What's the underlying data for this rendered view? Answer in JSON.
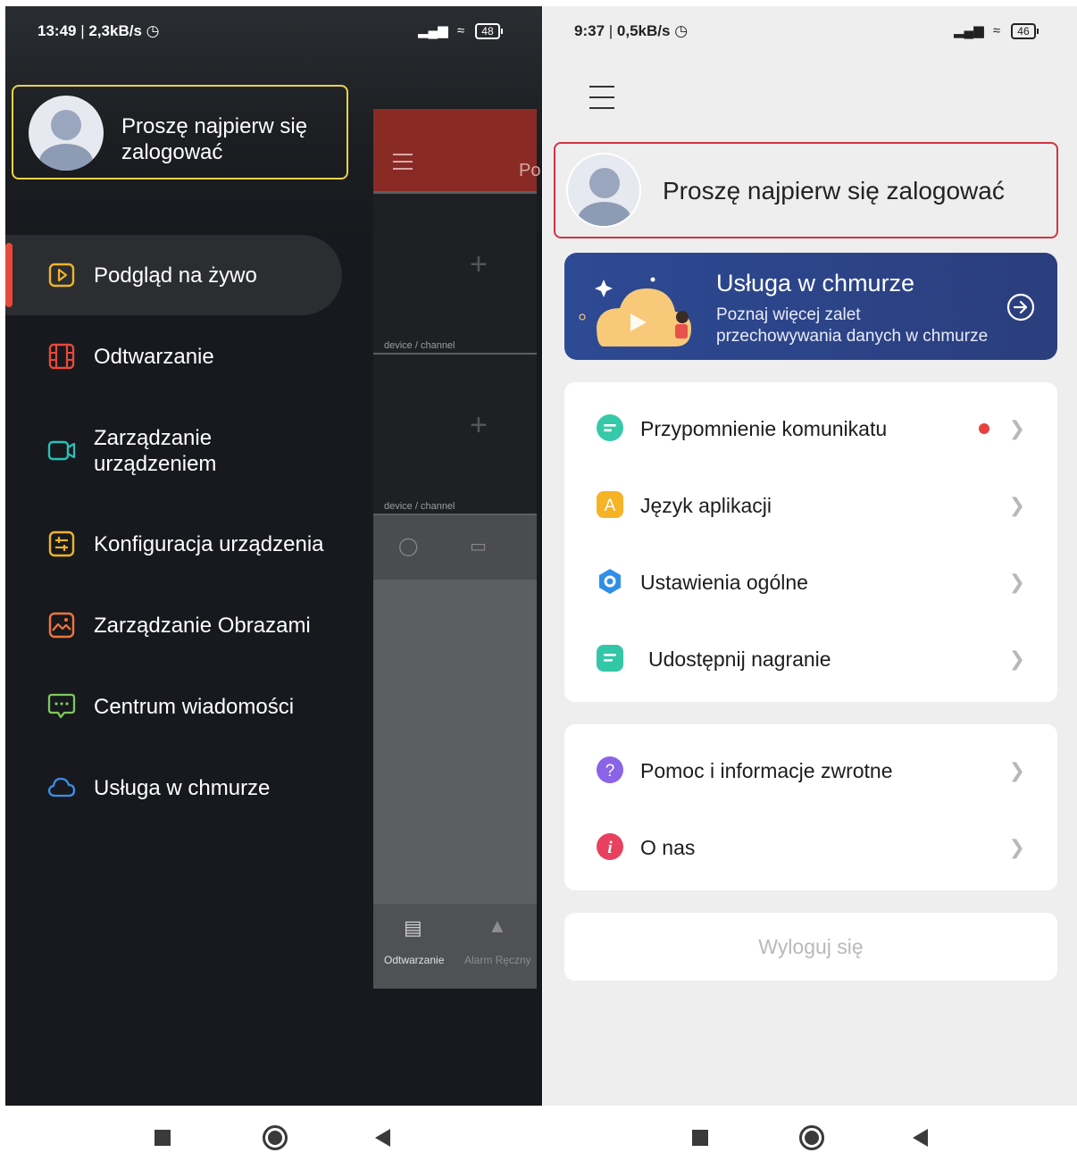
{
  "left_screen": {
    "status_bar": {
      "time": "13:49",
      "speed": "2,3kB/s",
      "battery": "48"
    },
    "login_prompt": "Proszę najpierw się zalogować",
    "menu_items": [
      {
        "label": "Podgląd na żywo",
        "icon": "play-square-icon",
        "color": "#f0b428",
        "active": true
      },
      {
        "label": "Odtwarzanie",
        "icon": "film-icon",
        "color": "#e8493b"
      },
      {
        "label": "Zarządzanie urządzeniem",
        "icon": "camera-icon",
        "color": "#26c2b8"
      },
      {
        "label": "Konfiguracja urządzenia",
        "icon": "sliders-icon",
        "color": "#f0b428"
      },
      {
        "label": "Zarządzanie Obrazami",
        "icon": "image-icon",
        "color": "#f0753a"
      },
      {
        "label": "Centrum wiadomości",
        "icon": "chat-icon",
        "color": "#7ec85a"
      },
      {
        "label": "Usługa w chmurze",
        "icon": "cloud-icon",
        "color": "#3d8ee8"
      }
    ],
    "background_app": {
      "header_text": "Po",
      "channel_labels": [
        "device / channel",
        "device / channel"
      ],
      "bottom_tabs": [
        "Odtwarzanie",
        "Alarm Ręczny"
      ]
    }
  },
  "right_screen": {
    "status_bar": {
      "time": "9:37",
      "speed": "0,5kB/s",
      "battery": "46"
    },
    "login_prompt": "Proszę najpierw się zalogować",
    "cloud_banner": {
      "title": "Usługa w chmurze",
      "subtitle_line1": "Poznaj więcej zalet",
      "subtitle_line2": "przechowywania danych w chmurze"
    },
    "settings_group_1": [
      {
        "label": "Przypomnienie komunikatu",
        "icon": "message-icon",
        "color": "#35c9a9",
        "badge": true
      },
      {
        "label": "Język aplikacji",
        "icon": "language-icon",
        "color": "#f5b325",
        "glyph": "A"
      },
      {
        "label": "Ustawienia ogólne",
        "icon": "settings-icon",
        "color": "#2f8fe8"
      },
      {
        "label": "Udostępnij nagranie",
        "icon": "share-icon",
        "color": "#33c7a8"
      }
    ],
    "settings_group_2": [
      {
        "label": "Pomoc i informacje zwrotne",
        "icon": "help-icon",
        "color": "#8a63e6",
        "glyph": "?"
      },
      {
        "label": "O nas",
        "icon": "info-icon",
        "color": "#e8415f",
        "glyph": "i"
      }
    ],
    "logout_label": "Wyloguj się"
  }
}
